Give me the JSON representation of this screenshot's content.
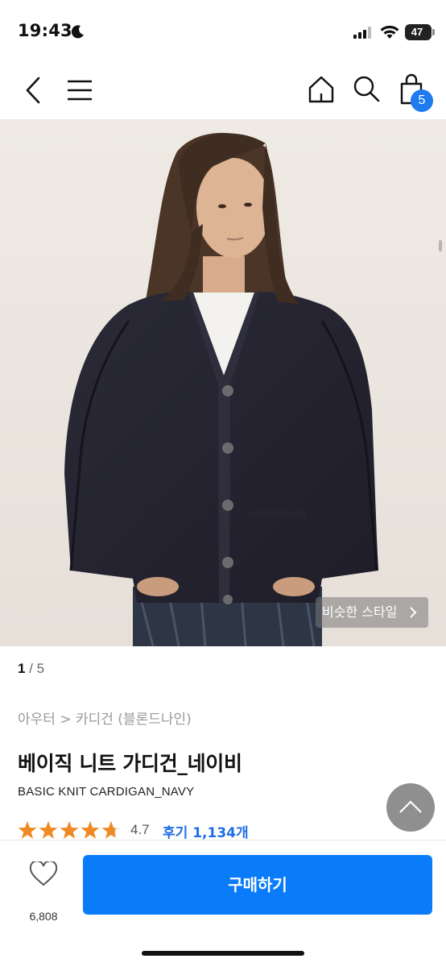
{
  "status_bar": {
    "time": "19:43",
    "battery": "47"
  },
  "nav": {
    "back_icon": "chevron-left-icon",
    "menu_icon": "hamburger-icon",
    "home_icon": "home-icon",
    "search_icon": "search-icon",
    "cart_icon": "shopping-bag-icon",
    "cart_count": "5"
  },
  "hero": {
    "similar_style_label": "비슷한 스타일",
    "counter_current": "1",
    "counter_total": "/ 5"
  },
  "product": {
    "breadcrumb": "아우터 > 카디건 (블론드나인)",
    "title": "베이직 니트 가디건_네이비",
    "subtitle": "BASIC KNIT CARDIGAN_NAVY",
    "rating": 4.7,
    "rating_text": "4.7",
    "review_label": "후기 1,134개",
    "star_color": "#f08a24"
  },
  "bottom_bar": {
    "like_count": "6,808",
    "buy_label": "구매하기",
    "accent": "#0a7cfa"
  }
}
